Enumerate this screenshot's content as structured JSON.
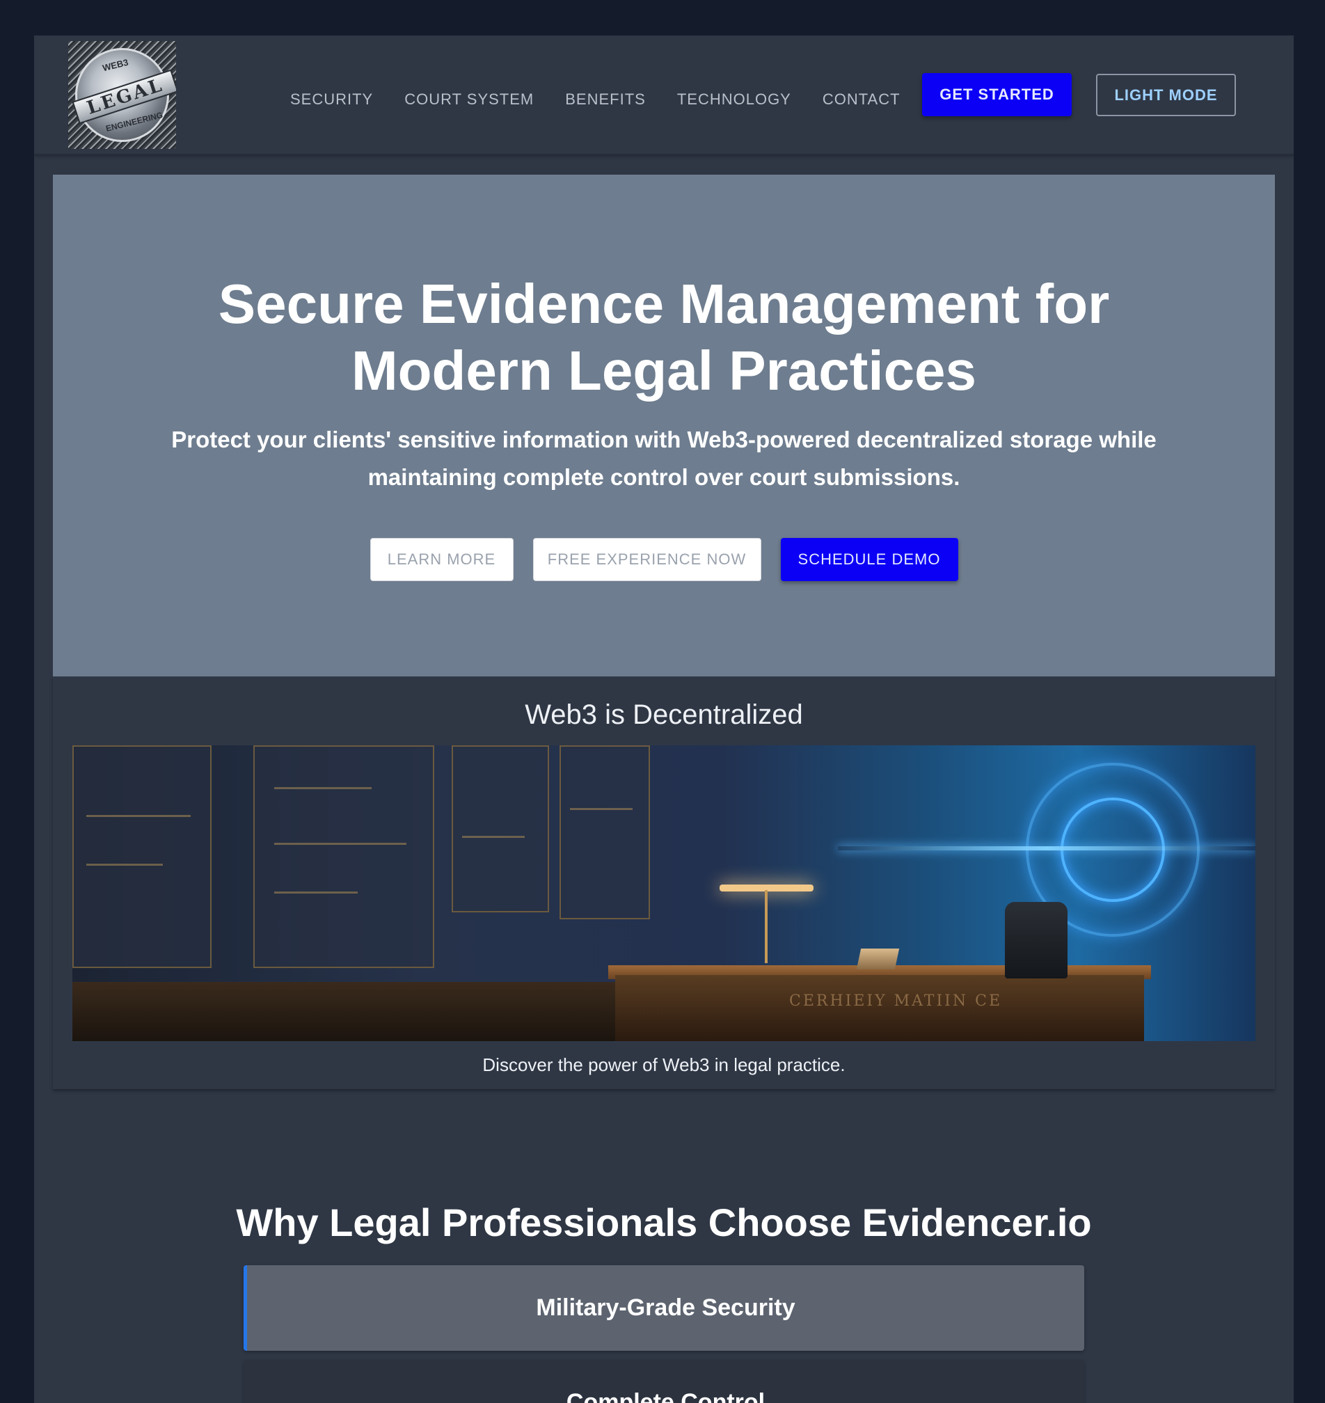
{
  "header": {
    "logo_text_top": "WEB3",
    "logo_text_main": "LEGAL",
    "logo_text_bottom": "ENGINEERING",
    "nav": [
      "SECURITY",
      "COURT SYSTEM",
      "BENEFITS",
      "TECHNOLOGY",
      "CONTACT"
    ],
    "get_started_label": "GET STARTED",
    "light_mode_label": "LIGHT MODE"
  },
  "hero": {
    "title": "Secure Evidence Management for Modern Legal Practices",
    "subtitle": "Protect your clients' sensitive information with Web3-powered decentralized storage while maintaining complete control over court submissions.",
    "buttons": {
      "learn_more": "LEARN MORE",
      "free_experience": "FREE EXPERIENCE NOW",
      "schedule_demo": "SCHEDULE DEMO"
    }
  },
  "web3": {
    "title": "Web3 is Decentralized",
    "image_desk_text": "CERHIEIY MATIIN CE",
    "caption": "Discover the power of Web3 in legal practice."
  },
  "why": {
    "title": "Why Legal Professionals Choose Evidencer.io",
    "features": [
      "Military-Grade Security",
      "Complete Control"
    ]
  },
  "colors": {
    "background": "#141b2b",
    "page": "#2f3745",
    "hero": "#6e7d8f",
    "primary_button": "#0b00f5",
    "accent": "#2576e8"
  }
}
